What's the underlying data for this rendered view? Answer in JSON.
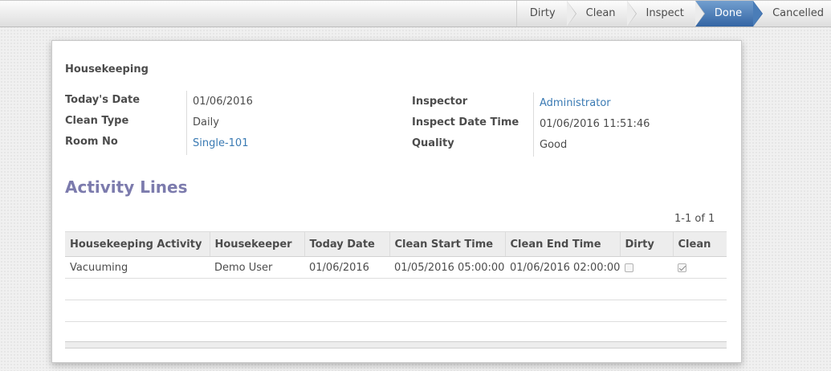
{
  "statusbar": {
    "stages": [
      {
        "label": "Dirty",
        "active": false
      },
      {
        "label": "Clean",
        "active": false
      },
      {
        "label": "Inspect",
        "active": false
      },
      {
        "label": "Done",
        "active": true
      },
      {
        "label": "Cancelled",
        "active": false
      }
    ]
  },
  "form": {
    "title": "Housekeeping",
    "left_fields": [
      {
        "label": "Today's Date",
        "value": "01/06/2016"
      },
      {
        "label": "Clean Type",
        "value": "Daily"
      },
      {
        "label": "Room No",
        "value": "Single-101"
      }
    ],
    "right_fields": [
      {
        "label": "Inspector",
        "value": "Administrator"
      },
      {
        "label": "Inspect Date Time",
        "value": "01/06/2016 11:51:46"
      },
      {
        "label": "Quality",
        "value": "Good"
      }
    ]
  },
  "activity": {
    "heading": "Activity Lines",
    "pager": "1-1 of 1",
    "columns": [
      "Housekeeping Activity",
      "Housekeeper",
      "Today Date",
      "Clean Start Time",
      "Clean End Time",
      "Dirty",
      "Clean"
    ],
    "rows": [
      {
        "activity": "Vacuuming",
        "housekeeper": "Demo User",
        "today_date": "01/06/2016",
        "start_time": "01/05/2016 05:00:00",
        "end_time": "01/06/2016 02:00:00",
        "dirty": false,
        "clean": true
      }
    ]
  },
  "colors": {
    "accent": "#3465a4",
    "link": "#3a7ab3",
    "heading": "#7c7bad"
  }
}
